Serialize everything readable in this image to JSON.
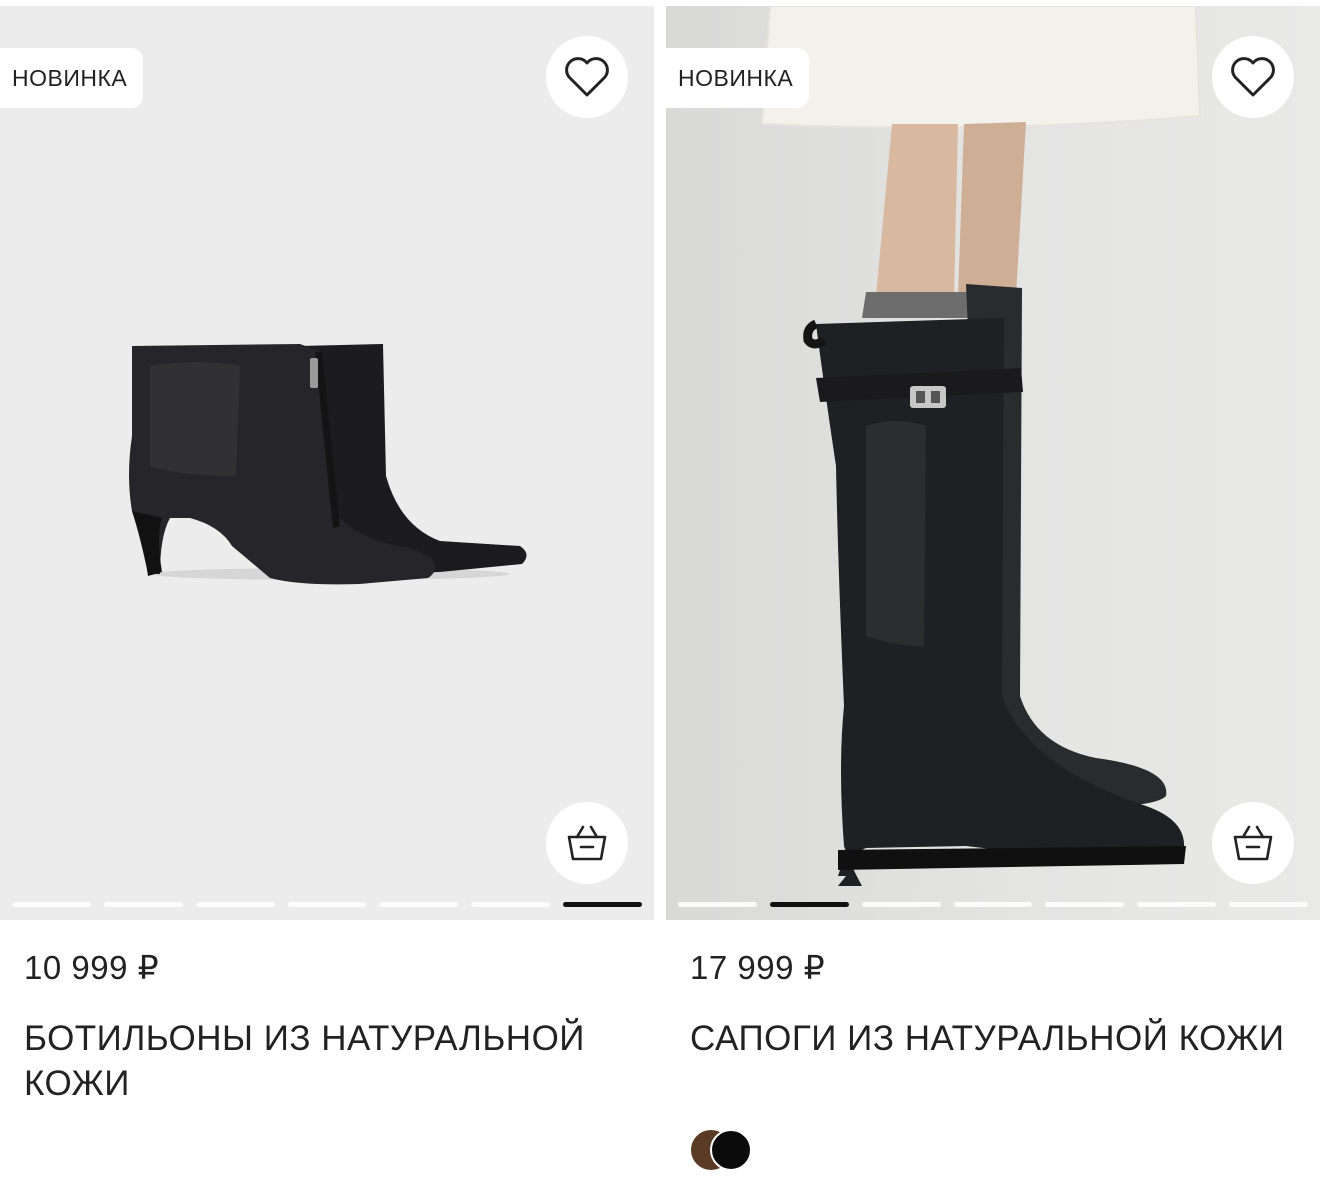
{
  "products": [
    {
      "badge": "НОВИНКА",
      "price": "10 999 ₽",
      "title": "БОТИЛЬОНЫ ИЗ НАТУРАЛЬНОЙ КОЖИ",
      "image_count": 7,
      "active_image": 7,
      "favorite_icon": "heart-outline-icon",
      "cart_icon": "basket-icon"
    },
    {
      "badge": "НОВИНКА",
      "price": "17 999 ₽",
      "title": "САПОГИ ИЗ НАТУРАЛЬНОЙ КОЖИ",
      "image_count": 7,
      "active_image": 2,
      "favorite_icon": "heart-outline-icon",
      "cart_icon": "basket-icon",
      "colors": [
        "#5a3b26",
        "#0b0b0b"
      ]
    }
  ]
}
